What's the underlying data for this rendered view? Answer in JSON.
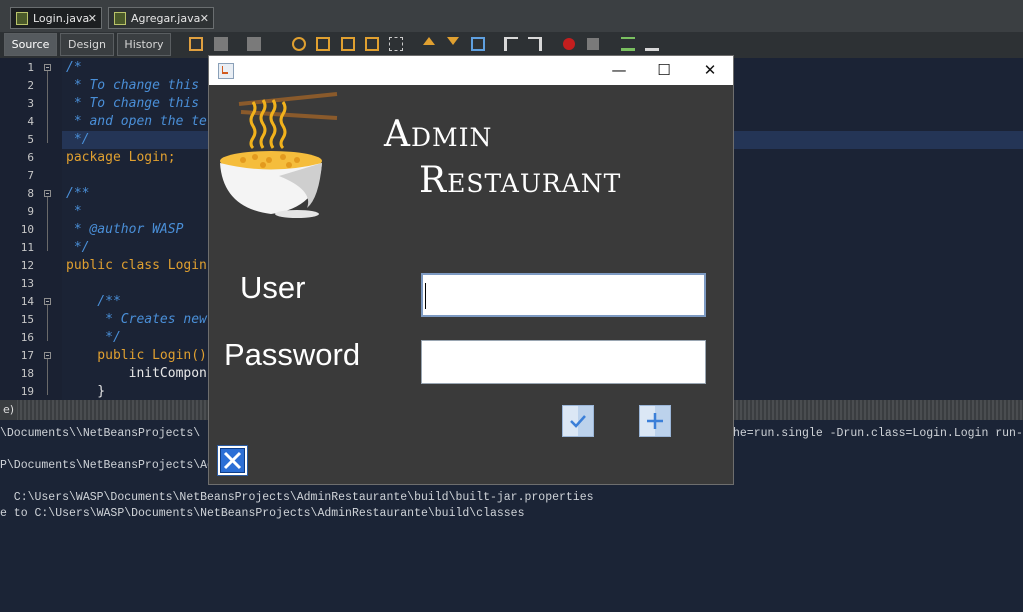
{
  "ide": {
    "tabs": [
      {
        "label": "Login.java",
        "close": "✕"
      },
      {
        "label": "Agregar.java",
        "close": "✕"
      }
    ],
    "modes": [
      "Source",
      "Design",
      "History"
    ],
    "line_numbers": [
      "1",
      "2",
      "3",
      "4",
      "5",
      "6",
      "7",
      "8",
      "9",
      "10",
      "11",
      "12",
      "13",
      "14",
      "15",
      "16",
      "17",
      "18",
      "19"
    ],
    "code_lines": [
      "/*",
      " * To change this",
      " * To change this",
      " * and open the te",
      " */",
      "package Login;",
      "",
      "/**",
      " *",
      " * @author WASP",
      " */",
      "public class Login",
      "",
      "    /**",
      "     * Creates new",
      "     */",
      "    public Login()",
      "        initCompon",
      "    }"
    ],
    "output_header": "e)",
    "output_lines": [
      "\\Documents\\\\NetBeansProjects\\",
      "P\\Documents\\NetBeansProjects\\Ad",
      "",
      "  C:\\Users\\WASP\\Documents\\NetBeansProjects\\AdminRestaurante\\build\\built-jar.properties",
      "e to C:\\Users\\WASP\\Documents\\NetBeansProjects\\AdminRestaurante\\build\\classes"
    ],
    "output_right": "he=run.single -Drun.class=Login.Login run-"
  },
  "dialog": {
    "window_controls": {
      "minimize": "—",
      "maximize": "☐",
      "close": "✕"
    },
    "title_line1": "Admin",
    "title_line2": "Restaurant",
    "user_label": "User",
    "password_label": "Password",
    "user_value": "",
    "password_value": "",
    "icons": {
      "logo": "noodle-bowl-icon",
      "confirm": "check-icon",
      "add": "plus-icon",
      "exit": "close-icon"
    }
  }
}
